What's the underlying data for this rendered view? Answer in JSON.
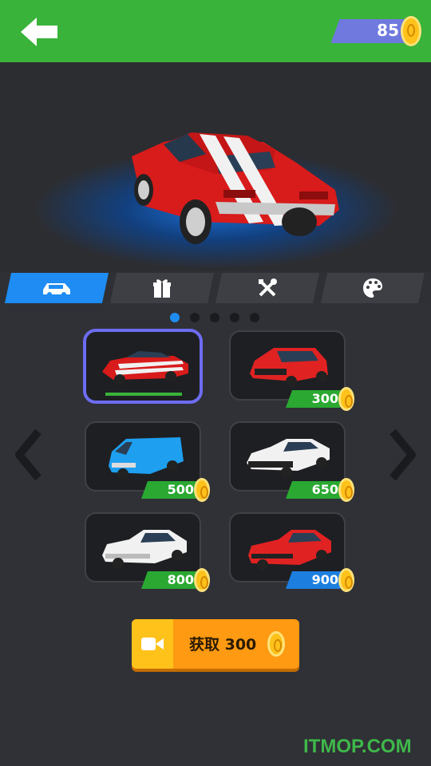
{
  "header": {
    "coins": "85",
    "back_icon": "arrow-left-icon",
    "colors": {
      "bar": "#39b33a",
      "coin_box": "#6f79de"
    }
  },
  "tabs": [
    {
      "name": "cars",
      "icon": "car-icon",
      "active": true
    },
    {
      "name": "gifts",
      "icon": "gift-icon",
      "active": false
    },
    {
      "name": "tools",
      "icon": "tools-icon",
      "active": false
    },
    {
      "name": "paint",
      "icon": "palette-icon",
      "active": false
    }
  ],
  "pagination": {
    "pages": 5,
    "current": 1
  },
  "cars": [
    {
      "id": "red-muscle",
      "color": "#d81b1b",
      "selected": true,
      "price": null
    },
    {
      "id": "red-hatch",
      "color": "#e02222",
      "price": "300",
      "price_color": "#2aa832"
    },
    {
      "id": "blue-van",
      "color": "#1e9ff0",
      "price": "500",
      "price_color": "#2aa832"
    },
    {
      "id": "white-coupe",
      "color": "#f1f1f1",
      "price": "650",
      "price_color": "#2aa832"
    },
    {
      "id": "white-sedan",
      "color": "#f1f1f1",
      "price": "800",
      "price_color": "#2aa832"
    },
    {
      "id": "red-sedan",
      "color": "#e02222",
      "price": "900",
      "price_color": "#1c7fe0"
    }
  ],
  "get_button": {
    "label": "获取 300",
    "icon": "video-icon"
  },
  "watermark": "ITMOP.COM"
}
